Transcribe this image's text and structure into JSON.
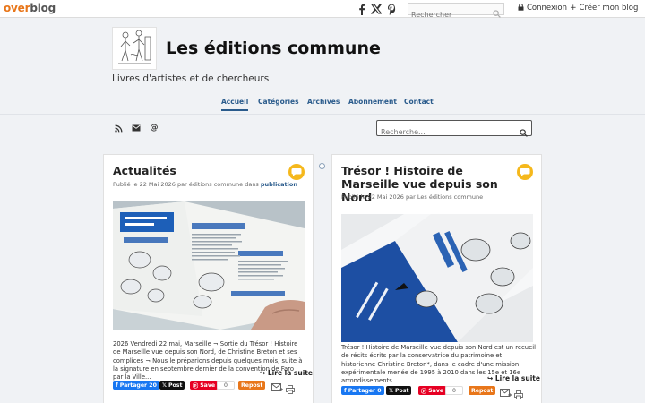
{
  "topbar": {
    "logo_part1": "over",
    "logo_part2": "blog",
    "search_placeholder": "Rechercher",
    "login_label": "Connexion",
    "create_label": "Créer mon blog",
    "social_icons": [
      "facebook-icon",
      "x-icon",
      "pinterest-icon"
    ]
  },
  "header": {
    "title": "Les éditions commune",
    "tagline": "Livres d'artistes et de chercheurs"
  },
  "nav": {
    "items": [
      "Accueil",
      "Catégories",
      "Archives",
      "Abonnement",
      "Contact"
    ],
    "active": "Accueil"
  },
  "tools": {
    "icons": [
      "rss-icon",
      "mail-icon",
      "at-icon"
    ],
    "search_placeholder": "Recherche..."
  },
  "posts": [
    {
      "title": "Actualités",
      "meta_prefix": "Publié le 22 Mai 2026 par éditions commune dans",
      "category": "publication",
      "excerpt": "2026 Vendredi 22 mai, Marseille ¬ Sortie du Trésor ! Histoire de Marseille vue depuis son Nord, de Christine Breton et ses complices ¬ Nous le préparions depuis quelques mois, suite à la signature en septembre dernier de la convention de Faro par la Ville...",
      "more": "Lire la suite",
      "share": {
        "fb_label": "Partager",
        "fb_count": "20",
        "post_label": "Post",
        "save_label": "Save",
        "save_count": "0",
        "repost_label": "Repost"
      }
    },
    {
      "title": "Trésor ! Histoire de Marseille vue depuis son Nord",
      "meta_prefix": "Publié le 22 Mai 2026 par Les éditions commune",
      "excerpt": "Trésor ! Histoire de Marseille vue depuis son Nord est un recueil de récits écrits par la conservatrice du patrimoine et historienne Christine Breton*, dans le cadre d'une mission expérimentale menée de 1995 à 2010 dans les 15e et 16e arrondissements...",
      "more": "Lire la suite",
      "share": {
        "fb_label": "Partager",
        "fb_count": "0",
        "post_label": "Post",
        "save_label": "Save",
        "save_count": "0",
        "repost_label": "Repost"
      }
    }
  ],
  "colors": {
    "accent": "#2a5b8c",
    "logo_orange": "#e8761a",
    "badge": "#f5b81c",
    "facebook": "#1877f2",
    "pinterest": "#e60023"
  }
}
